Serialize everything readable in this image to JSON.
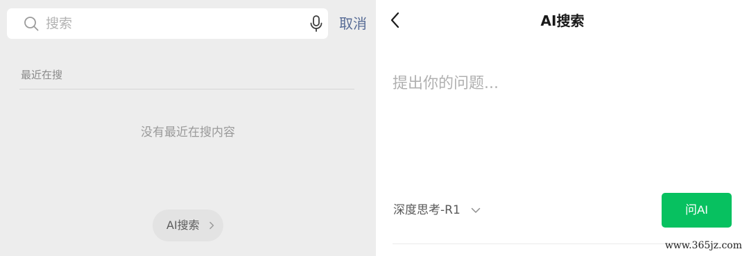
{
  "search_panel": {
    "search": {
      "placeholder": "搜索",
      "search_icon": "search-icon",
      "mic_icon": "microphone-icon"
    },
    "cancel_label": "取消",
    "recent_title": "最近在搜",
    "empty_text": "没有最近在搜内容",
    "ai_search_pill": {
      "label": "AI搜索",
      "icon": "chevron-right-icon"
    }
  },
  "ai_panel": {
    "back_icon": "chevron-left-icon",
    "title": "AI搜索",
    "question_placeholder": "提出你的问题...",
    "model_select": {
      "selected": "深度思考-R1",
      "icon": "chevron-down-icon"
    },
    "ask_button_label": "问AI"
  },
  "watermark": "www.365jz.com",
  "colors": {
    "left_background": "#ededed",
    "cancel_link": "#576b95",
    "ask_button": "#07c160",
    "pill_background": "#e3e3e3"
  }
}
